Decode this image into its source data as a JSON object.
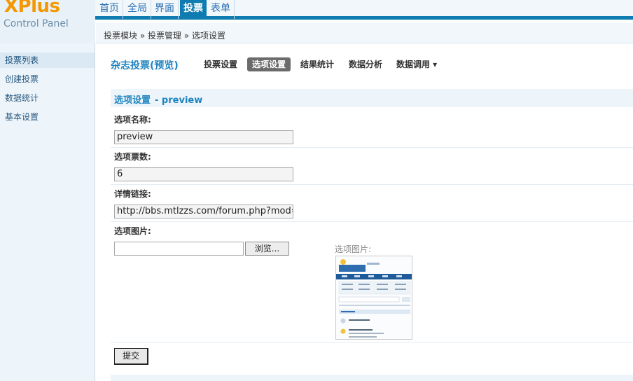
{
  "brand": {
    "name": "XPlus",
    "subtitle": "Control Panel"
  },
  "topnav": {
    "items": [
      {
        "label": "首页"
      },
      {
        "label": "全局"
      },
      {
        "label": "界面"
      },
      {
        "label": "投票"
      },
      {
        "label": "表单"
      }
    ],
    "active_index": 3
  },
  "breadcrumb": "投票模块 » 投票管理 » 选项设置",
  "sidebar": {
    "items": [
      {
        "label": "投票列表"
      },
      {
        "label": "创建投票"
      },
      {
        "label": "数据统计"
      },
      {
        "label": "基本设置"
      }
    ],
    "active_index": 0
  },
  "page": {
    "title": "杂志投票(预览)",
    "tabs": [
      {
        "label": "投票设置"
      },
      {
        "label": "选项设置"
      },
      {
        "label": "结果统计"
      },
      {
        "label": "数据分析"
      },
      {
        "label": "数据调用 ▾"
      }
    ],
    "active_tab_index": 1
  },
  "form": {
    "section_title": "选项设置",
    "section_name": "- preview",
    "option_name_label": "选项名称:",
    "option_name_value": "preview",
    "votes_label": "选项票数:",
    "votes_value": "6",
    "link_label": "详情链接:",
    "link_value": "http://bbs.mtlzzs.com/forum.php?mod=v",
    "image_label": "选项图片:",
    "browse_button": "浏览...",
    "preview_label": "选项图片:",
    "submit_button": "提交"
  },
  "colors": {
    "accent": "#0e7cb0",
    "brand_orange": "#f39800",
    "title_blue": "#1e84c0"
  }
}
